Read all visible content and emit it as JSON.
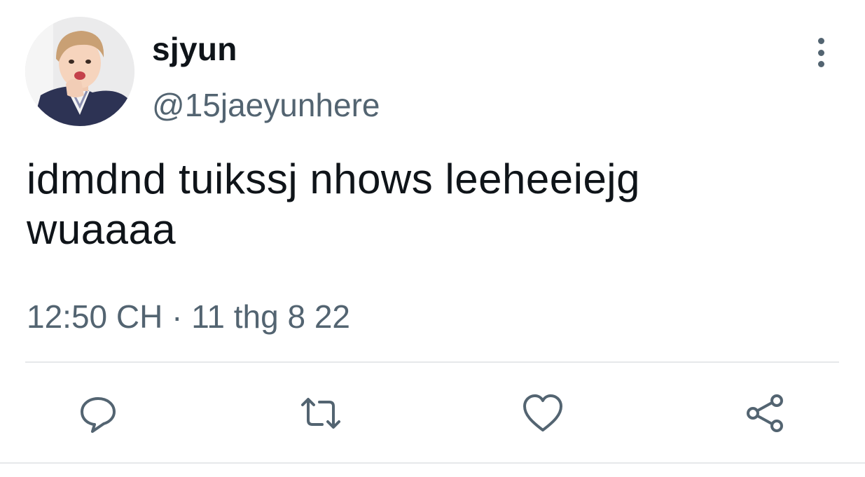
{
  "tweet": {
    "display_name": "sjyun",
    "handle": "@15jaeyunhere",
    "text": "idmdnd tuikssj nhows leeheeiejg\nwuaaaa",
    "timestamp": "12:50 CH · 11 thg 8 22"
  },
  "icons": {
    "more": "more-vertical-icon",
    "reply": "reply-icon",
    "retweet": "retweet-icon",
    "like": "heart-icon",
    "share": "share-icon"
  },
  "colors": {
    "text_primary": "#0f1419",
    "text_secondary": "#536471",
    "divider": "#e6e8ea",
    "background": "#ffffff"
  }
}
